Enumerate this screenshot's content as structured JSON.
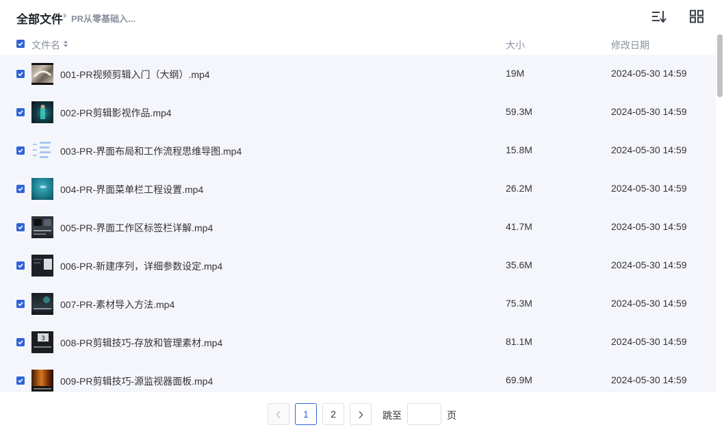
{
  "breadcrumb": {
    "title": "全部文件",
    "current": "PR从零基础入..."
  },
  "columns": {
    "name": "文件名",
    "size": "大小",
    "date": "修改日期"
  },
  "files": [
    {
      "name": "001-PR视频剪辑入门（大纲）.mp4",
      "size": "19M",
      "date": "2024-05-30 14:59",
      "checked": true
    },
    {
      "name": "002-PR剪辑影视作品.mp4",
      "size": "59.3M",
      "date": "2024-05-30 14:59",
      "checked": true
    },
    {
      "name": "003-PR-界面布局和工作流程思维导图.mp4",
      "size": "15.8M",
      "date": "2024-05-30 14:59",
      "checked": true
    },
    {
      "name": "004-PR-界面菜单栏工程设置.mp4",
      "size": "26.2M",
      "date": "2024-05-30 14:59",
      "checked": true
    },
    {
      "name": "005-PR-界面工作区标签栏详解.mp4",
      "size": "41.7M",
      "date": "2024-05-30 14:59",
      "checked": true
    },
    {
      "name": "006-PR-新建序列，详细参数设定.mp4",
      "size": "35.6M",
      "date": "2024-05-30 14:59",
      "checked": true
    },
    {
      "name": "007-PR-素材导入方法.mp4",
      "size": "75.3M",
      "date": "2024-05-30 14:59",
      "checked": true
    },
    {
      "name": "008-PR剪辑技巧-存放和管理素材.mp4",
      "size": "81.1M",
      "date": "2024-05-30 14:59",
      "checked": true
    },
    {
      "name": "009-PR剪辑技巧-源监视器面板.mp4",
      "size": "69.9M",
      "date": "2024-05-30 14:59",
      "checked": true
    }
  ],
  "pagination": {
    "pages": [
      "1",
      "2"
    ],
    "current": "1",
    "jump_label": "跳至",
    "jump_value": "",
    "jump_unit": "页"
  },
  "colors": {
    "accent": "#2f63d8",
    "row_bg": "#f5f6fc",
    "muted_text": "#8a919f"
  },
  "icons": {
    "sort": "sort-list-icon",
    "grid": "grid-view-icon",
    "prev": "chevron-left-icon",
    "next": "chevron-right-icon"
  }
}
